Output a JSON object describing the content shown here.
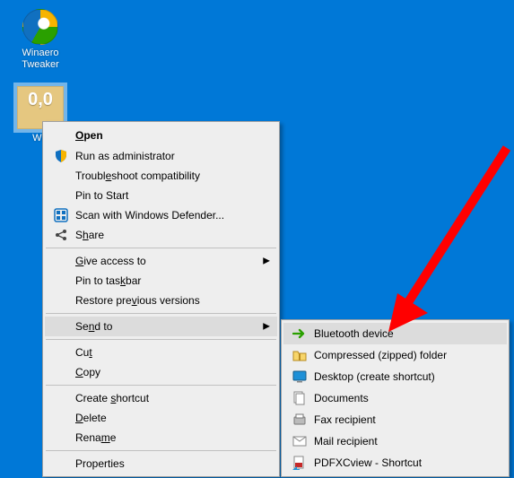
{
  "desktop": {
    "icons": [
      {
        "name": "winaero-tweaker",
        "label": "Winaero\nTweaker"
      },
      {
        "name": "we-shortcut",
        "label": "WE",
        "tile_text": "0,0",
        "selected": true
      }
    ]
  },
  "context_menu": {
    "open": "Open",
    "run_as_admin": "Run as administrator",
    "troubleshoot": "Troubleshoot compatibility",
    "pin_start": "Pin to Start",
    "scan_defender": "Scan with Windows Defender...",
    "share": "Share",
    "give_access": "Give access to",
    "pin_taskbar": "Pin to taskbar",
    "restore_versions": "Restore previous versions",
    "send_to": "Send to",
    "cut": "Cut",
    "copy": "Copy",
    "create_shortcut": "Create shortcut",
    "delete": "Delete",
    "rename": "Rename",
    "properties": "Properties"
  },
  "sendto_menu": {
    "bluetooth": "Bluetooth device",
    "compressed": "Compressed (zipped) folder",
    "desktop_shortcut": "Desktop (create shortcut)",
    "documents": "Documents",
    "fax": "Fax recipient",
    "mail": "Mail recipient",
    "pdfxcview": "PDFXCview - Shortcut"
  },
  "annotation": {
    "arrow_color": "#ff0000"
  }
}
